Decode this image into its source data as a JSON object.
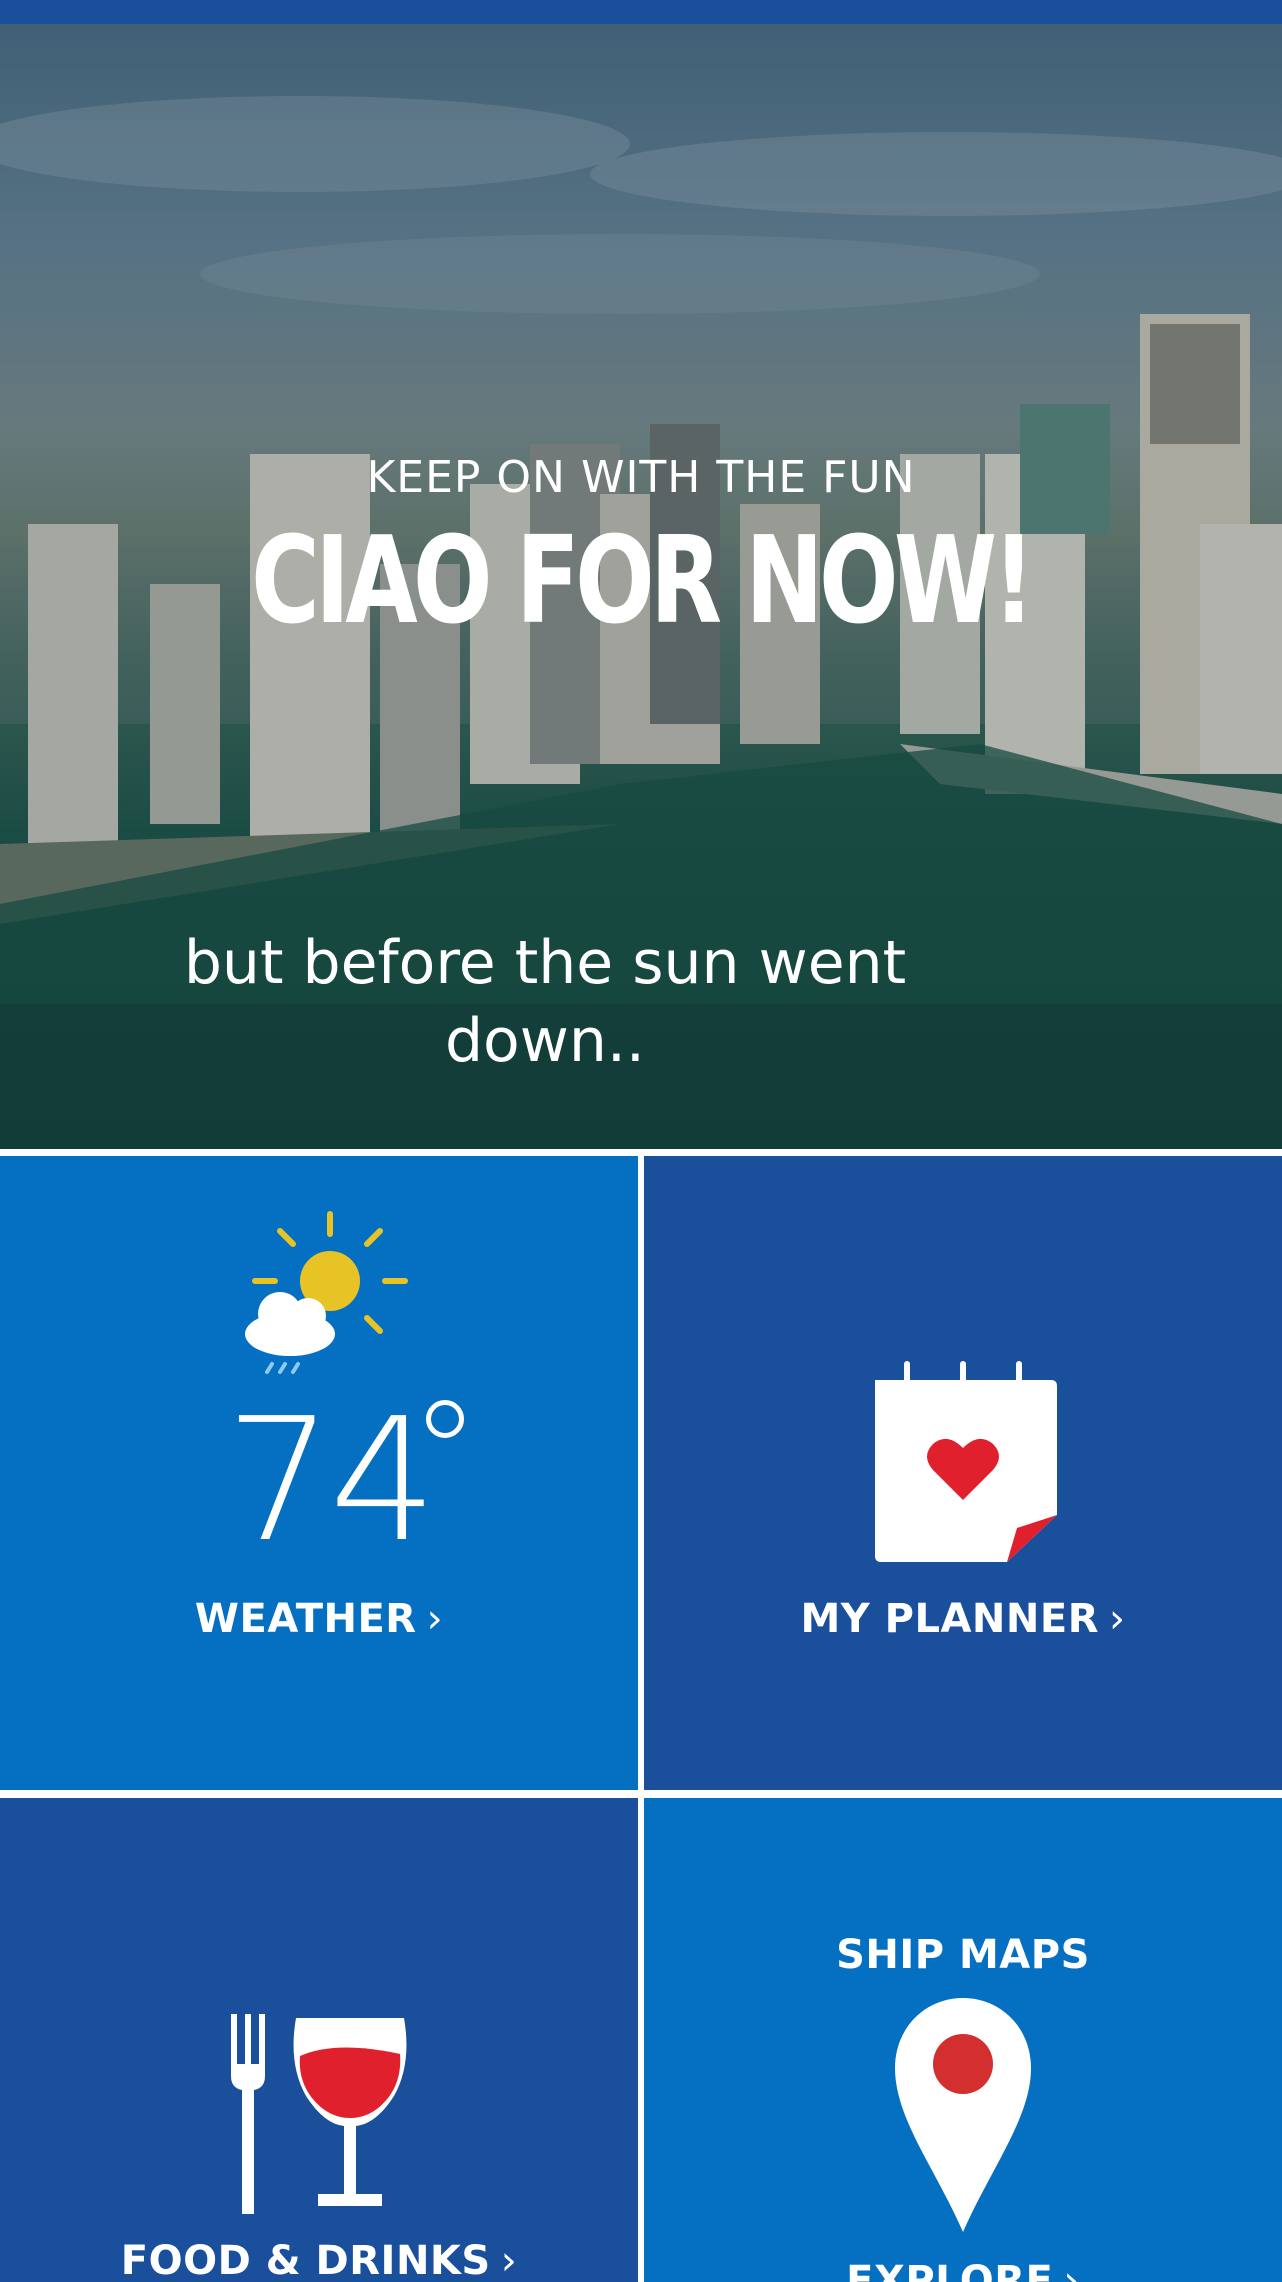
{
  "colors": {
    "status_bar": "#1a4f9c",
    "tile_light_blue": "#0570c1",
    "tile_dark_blue": "#1a4f9c",
    "accent_red": "#e0212d",
    "sun_yellow": "#e8c326",
    "text": "#ffffff"
  },
  "hero": {
    "kicker": "KEEP ON WITH THE FUN",
    "title": "CIAO FOR NOW!",
    "caption": "but before the sun went down.."
  },
  "tiles": {
    "weather": {
      "temperature": "74",
      "label": "WEATHER",
      "chevron": "›",
      "icon": "partly-cloudy-rain-icon"
    },
    "planner": {
      "label": "MY PLANNER",
      "chevron": "›",
      "icon": "calendar-heart-icon"
    },
    "food": {
      "label": "FOOD & DRINKS",
      "chevron": "›",
      "icon": "fork-wine-glass-icon"
    },
    "maps": {
      "title": "SHIP MAPS",
      "label": "EXPLORE",
      "chevron": "›",
      "icon": "map-pin-icon"
    }
  }
}
